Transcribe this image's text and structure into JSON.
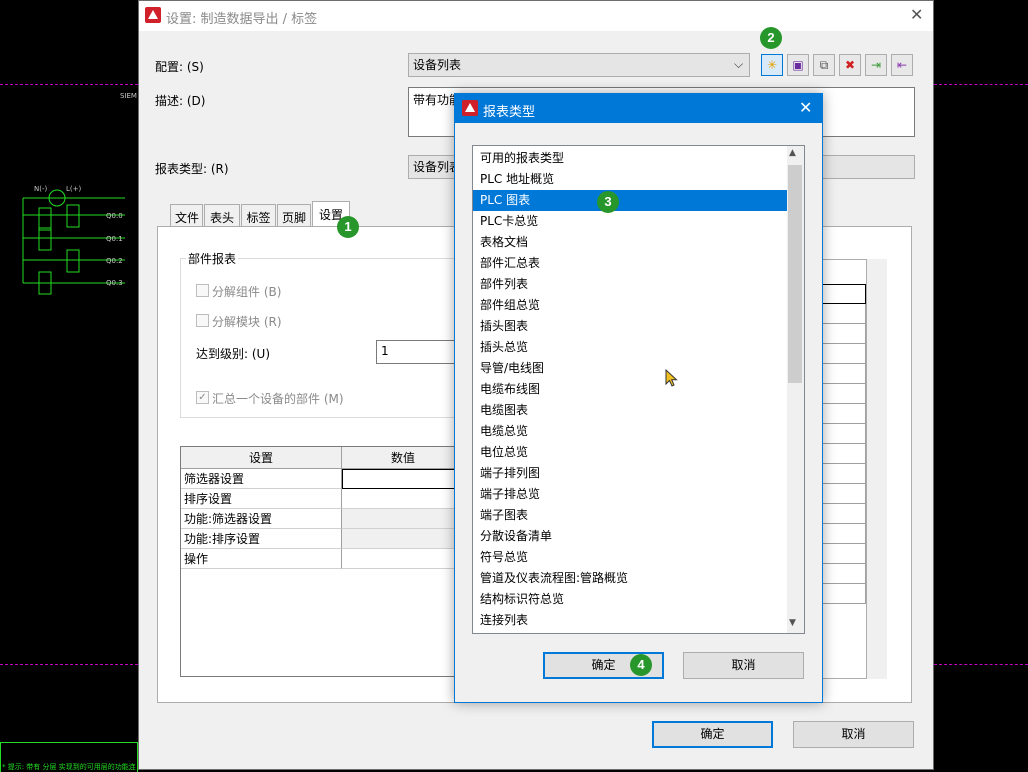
{
  "main_dialog": {
    "title": "设置: 制造数据导出 / 标签",
    "config_label": "配置: (S)",
    "config_value": "设备列表",
    "desc_label": "描述: (D)",
    "desc_value": "带有功能文本和设备标识符的设备列表",
    "report_type_label": "报表类型: (R)",
    "report_type_value": "设备列表",
    "tabs": [
      "文件",
      "表头",
      "标签",
      "页脚",
      "设置"
    ],
    "parts_group": "部件报表",
    "split_component": "分解组件 (B)",
    "split_module": "分解模块 (R)",
    "to_level_label": "达到级别: (U)",
    "to_level_value": "1",
    "summarize_parts": "汇总一个设备的部件 (M)",
    "grid_headers": [
      "设置",
      "数值"
    ],
    "grid_rows": [
      "筛选器设置",
      "排序设置",
      "功能:筛选器设置",
      "功能:排序设置",
      "操作"
    ],
    "ok": "确定",
    "cancel": "取消"
  },
  "report_dialog": {
    "title": "报表类型",
    "items": [
      "可用的报表类型",
      "PLC 地址概览",
      "PLC 图表",
      "PLC卡总览",
      "表格文档",
      "部件汇总表",
      "部件列表",
      "部件组总览",
      "插头图表",
      "插头总览",
      "导管/电线图",
      "电缆布线图",
      "电缆图表",
      "电缆总览",
      "电位总览",
      "端子排列图",
      "端子排总览",
      "端子图表",
      "分散设备清单",
      "符号总览",
      "管道及仪表流程图:管路概览",
      "结构标识符总览",
      "连接列表"
    ],
    "selected_index": 2,
    "ok": "确定",
    "cancel": "取消"
  },
  "badges": [
    "1",
    "2",
    "3",
    "4"
  ],
  "cad": {
    "siem_label": "SIEM",
    "status_text": "* 提示: 带有 分层 实现到的可用层的功能连接",
    "q_labels": [
      "Q0.0",
      "Q0.1",
      "Q0.2",
      "Q0.3"
    ],
    "power_labels": [
      "N(-)",
      "L(+)"
    ]
  },
  "colors": {
    "accent": "#0078d7",
    "badge": "#27962b",
    "logo_red": "#d0202a"
  }
}
